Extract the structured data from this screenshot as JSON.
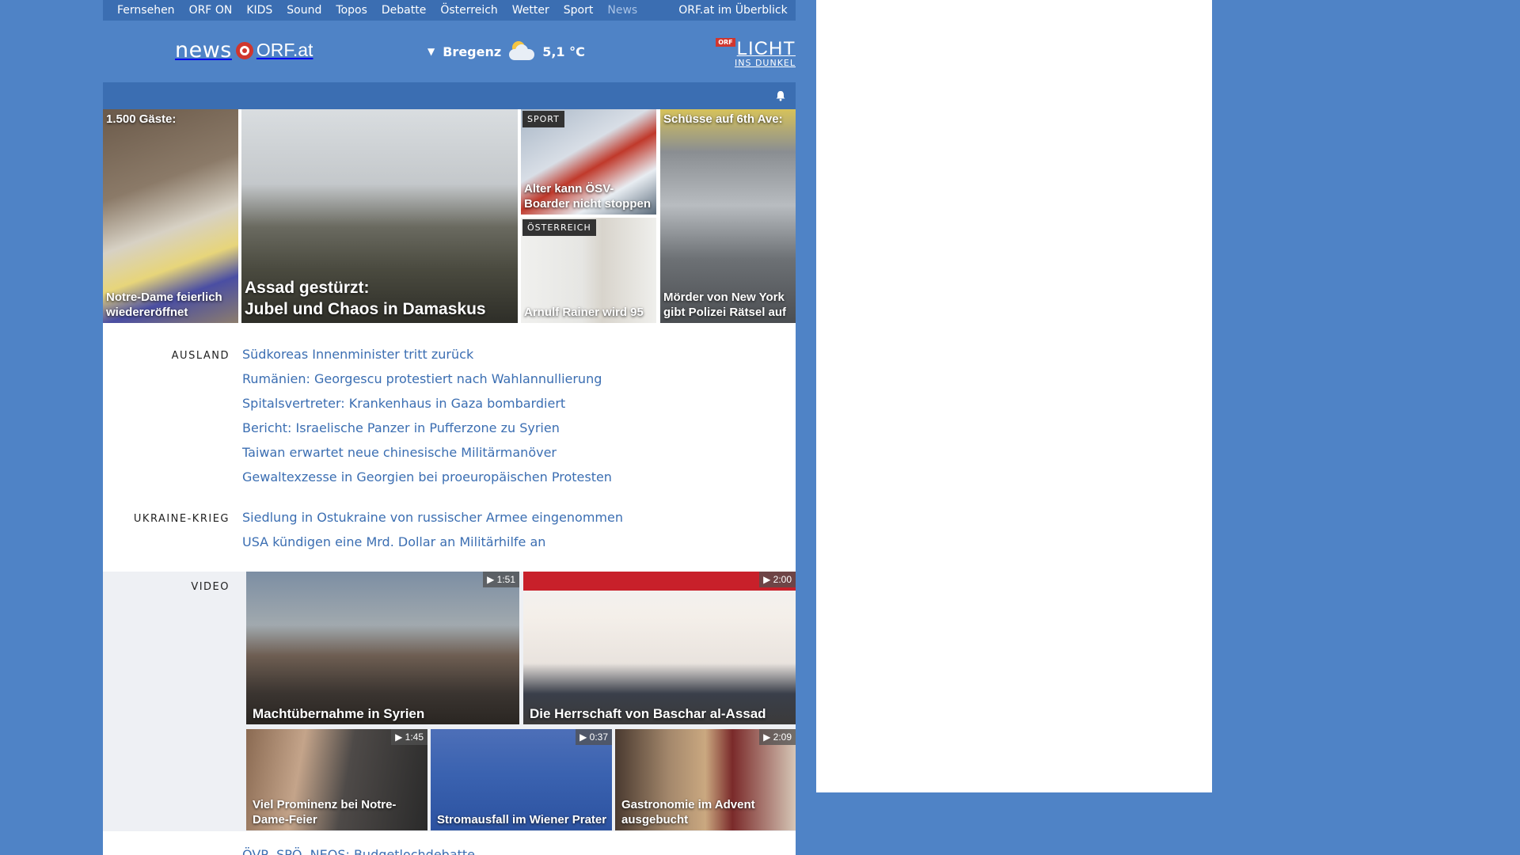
{
  "topnav": [
    "Fernsehen",
    "ORF ON",
    "KIDS",
    "Sound",
    "Topos",
    "Debatte",
    "Österreich",
    "Wetter",
    "Sport",
    "News"
  ],
  "topnav_overview": "ORF.at im Überblick",
  "logo": {
    "news": "news",
    "orf": "ORF.at"
  },
  "weather": {
    "location": "Bregenz",
    "temperature": "5,1 °C",
    "icon": "partly-cloudy-icon"
  },
  "licht": {
    "badge": "ORF",
    "title": "LICHT",
    "subtitle": "INS DUNKEL"
  },
  "top_stories": {
    "notre_dame": {
      "label": "1.500 Gäste:",
      "caption": "Notre-Dame feierlich wiedereröffnet"
    },
    "assad": {
      "caption_line1": "Assad gestürzt:",
      "caption_line2": "Jubel und Chaos in Damaskus"
    },
    "sport": {
      "badge": "SPORT",
      "caption": "Alter kann ÖSV-Boarder nicht stoppen"
    },
    "oesterreich": {
      "badge": "ÖSTERREICH",
      "caption": "Arnulf Rainer wird 95"
    },
    "newyork": {
      "label": "Schüsse auf 6th Ave:",
      "caption": "Mörder von New York gibt Polizei Rätsel auf"
    }
  },
  "ausland": {
    "label": "AUSLAND",
    "items": [
      "Südkoreas Innenminister tritt zurück",
      "Rumänien: Georgescu protestiert nach Wahlannullierung",
      "Spitalsvertreter: Krankenhaus in Gaza bombardiert",
      "Bericht: Israelische Panzer in Pufferzone zu Syrien",
      "Taiwan erwartet neue chinesische Militärmanöver",
      "Gewaltexzesse in Georgien bei proeuropäischen Protesten"
    ]
  },
  "ukraine": {
    "label": "UKRAINE-KRIEG",
    "items": [
      "Siedlung in Ostukraine von russischer Armee eingenommen",
      "USA kündigen eine Mrd. Dollar an Militärhilfe an"
    ]
  },
  "video": {
    "label": "VIDEO",
    "items": [
      {
        "title": "Machtübernahme in Syrien",
        "duration": "1:51"
      },
      {
        "title": "Die Herrschaft von Baschar al-Assad",
        "duration": "2:00"
      },
      {
        "title": "Viel Prominenz bei Notre-Dame-Feier",
        "duration": "1:45"
      },
      {
        "title": "Stromausfall im Wiener Prater",
        "duration": "0:37"
      },
      {
        "title": "Gastronomie im Advent ausgebucht",
        "duration": "2:09"
      }
    ]
  },
  "cut_headline": "ÖVP, SPÖ, NEOS: Budgetlochdebatte",
  "colors": {
    "page_bg": "#4f83c6",
    "nav_bg": "#3b6eb2",
    "link": "#3b6eb2",
    "accent": "#d0362e"
  }
}
